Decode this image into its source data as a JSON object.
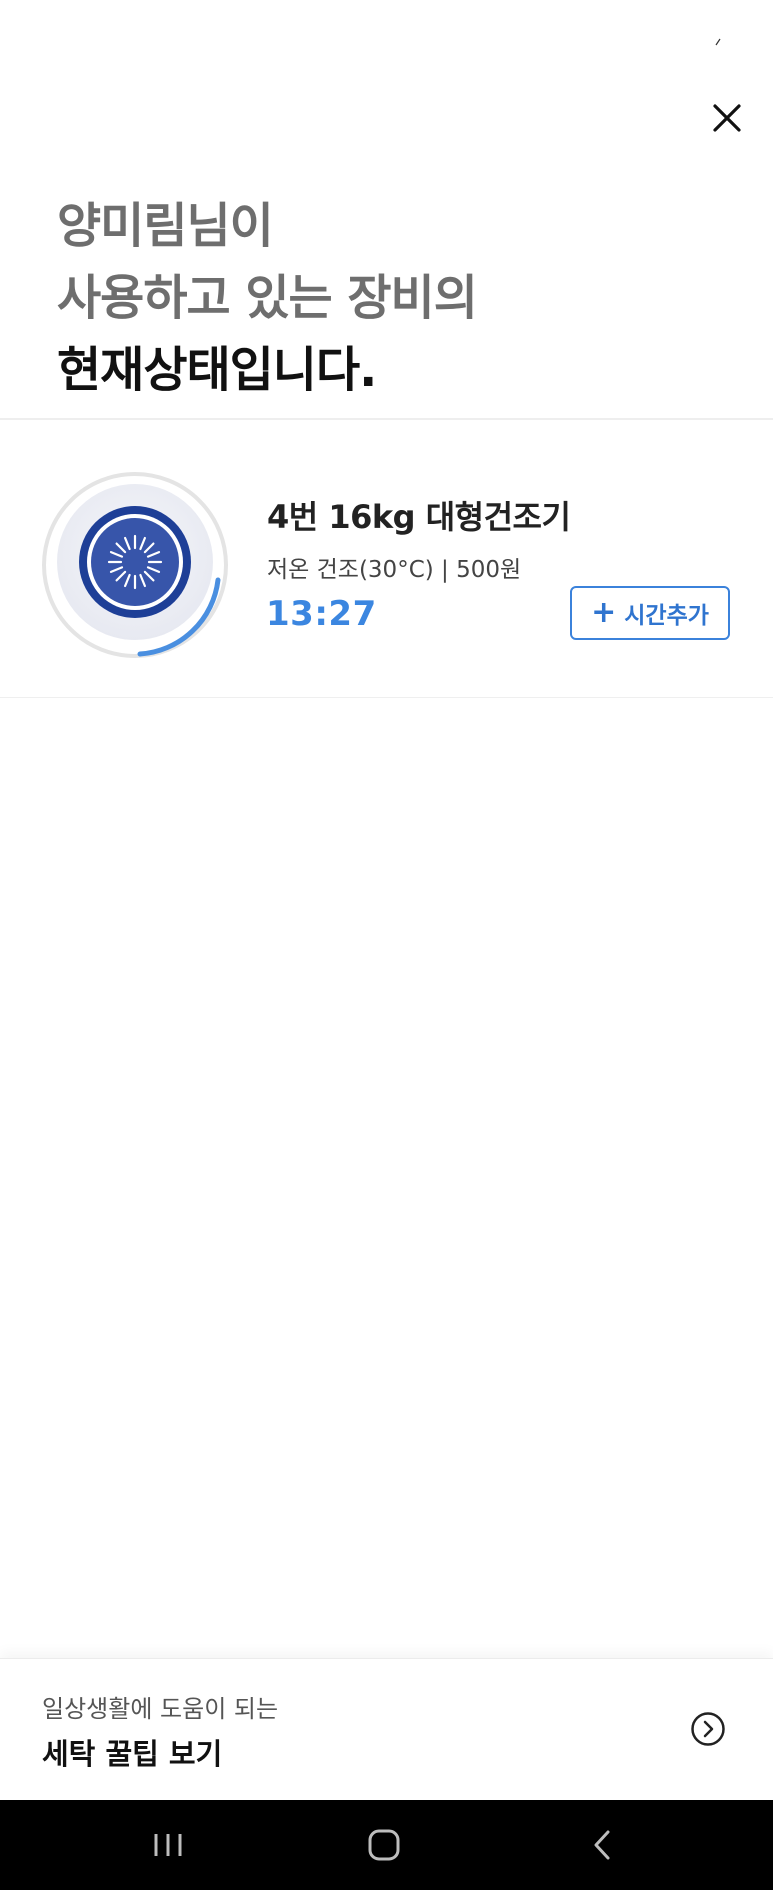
{
  "header": {
    "status_icon": "status-dot-icon",
    "close_icon": "close-icon"
  },
  "headline": {
    "line1": "양미림님이",
    "line2": "사용하고 있는 장비의",
    "line3": "현재상태입니다."
  },
  "device": {
    "icon": "dryer-icon",
    "name": "4번 16kg 대형건조기",
    "mode": "저온 건조(30°C) | 500원",
    "remaining_time": "13:27",
    "add_time_label": "시간추가",
    "add_time_icon": "plus-icon",
    "accent_color": "#3b86e0"
  },
  "tips_banner": {
    "subtitle": "일상생활에 도움이 되는",
    "title": "세탁 꿀팁 보기",
    "arrow_icon": "chevron-right-circle-icon"
  },
  "nav_bar": {
    "recent_icon": "recent-apps-icon",
    "home_icon": "home-icon",
    "back_icon": "back-icon"
  }
}
